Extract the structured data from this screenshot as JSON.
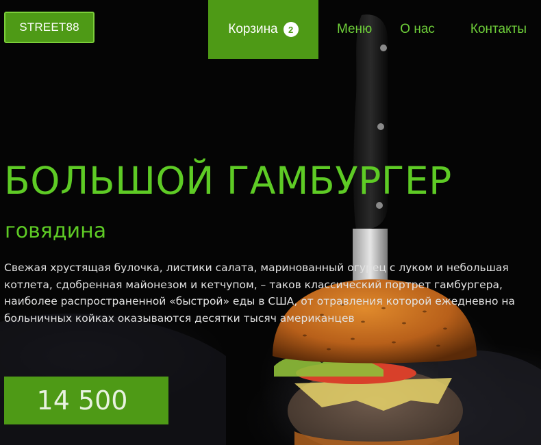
{
  "header": {
    "logo": "STREET88",
    "cart_label": "Корзина",
    "cart_count": "2",
    "nav": [
      {
        "label": "Меню"
      },
      {
        "label": "О нас"
      },
      {
        "label": "Контакты"
      }
    ]
  },
  "product": {
    "title": "БОЛЬШОЙ ГАМБУРГЕР",
    "subtitle": "говядина",
    "description": "Свежая хрустящая булочка, листики салата, маринованный огурец с луком и небольшая котлета, сдобренная майонезом и кетчупом, – таков классический портрет гамбургера, наиболее распространенной «быстрой» еды в США, от отравления которой ежедневно на больничных койках оказываются десятки тысяч американцев",
    "price": "14 500"
  },
  "colors": {
    "accent": "#4e9a16",
    "accent_text": "#5ecb25",
    "nav_text": "#6fd03a",
    "background": "#050505"
  },
  "icons": {
    "background_image": "burger-with-knife-photo"
  }
}
